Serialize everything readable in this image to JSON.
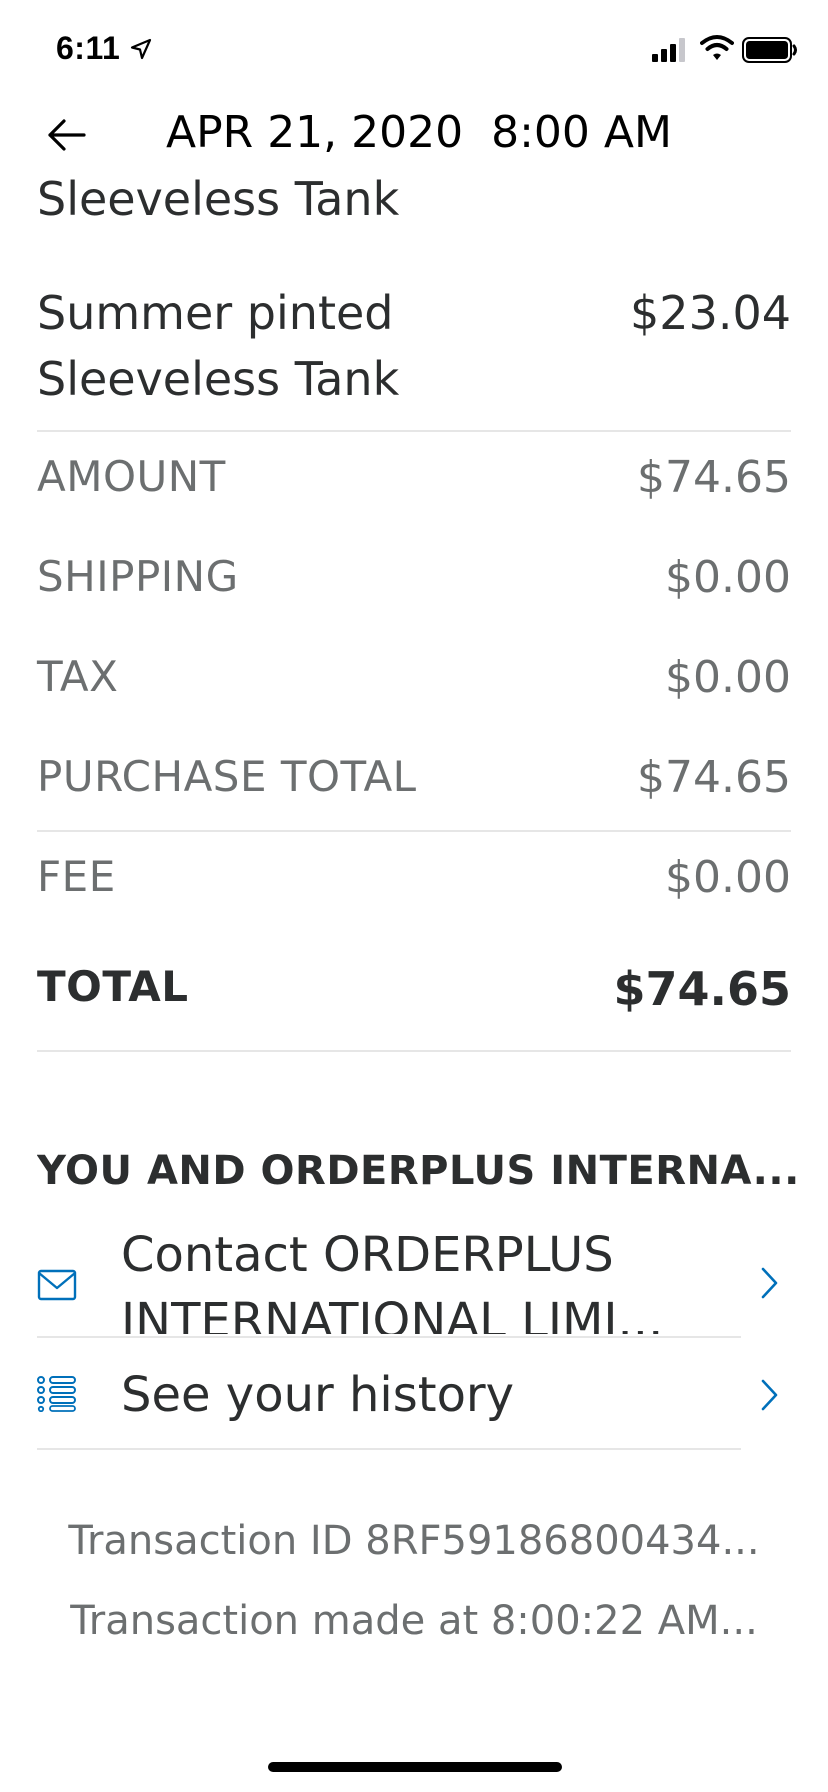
{
  "status_bar": {
    "time": "6:11",
    "icons": [
      "location-arrow-icon",
      "cellular-signal-icon",
      "wifi-icon",
      "battery-icon"
    ]
  },
  "header": {
    "back_icon": "arrow-left-icon",
    "title": "APR 21, 2020  8:00 AM"
  },
  "items": {
    "partial_name": "Sleeveless Tank",
    "line_item": {
      "name": "Summer pinted Sleeveless Tank",
      "price": "$23.04"
    }
  },
  "summary": {
    "amount": {
      "label": "AMOUNT",
      "value": "$74.65"
    },
    "shipping": {
      "label": "SHIPPING",
      "value": "$0.00"
    },
    "tax": {
      "label": "TAX",
      "value": "$0.00"
    },
    "purchase_total": {
      "label": "PURCHASE TOTAL",
      "value": "$74.65"
    },
    "fee": {
      "label": "FEE",
      "value": "$0.00"
    },
    "total": {
      "label": "TOTAL",
      "value": "$74.65"
    }
  },
  "merchant_section": {
    "title": "YOU AND ORDERPLUS INTERNA...",
    "links": [
      {
        "icon": "envelope-icon",
        "label": "Contact ORDERPLUS INTERNATIONAL LIMI..."
      },
      {
        "icon": "list-icon",
        "label": "See your history"
      }
    ]
  },
  "footer": {
    "transaction_id": "Transaction ID 8RF59186800434...",
    "transaction_time": "Transaction made at 8:00:22 AM..."
  },
  "colors": {
    "text_primary": "#2c2e2f",
    "text_secondary": "#6c6f70",
    "accent_blue": "#0070ba",
    "divider": "#e6e6e6"
  }
}
